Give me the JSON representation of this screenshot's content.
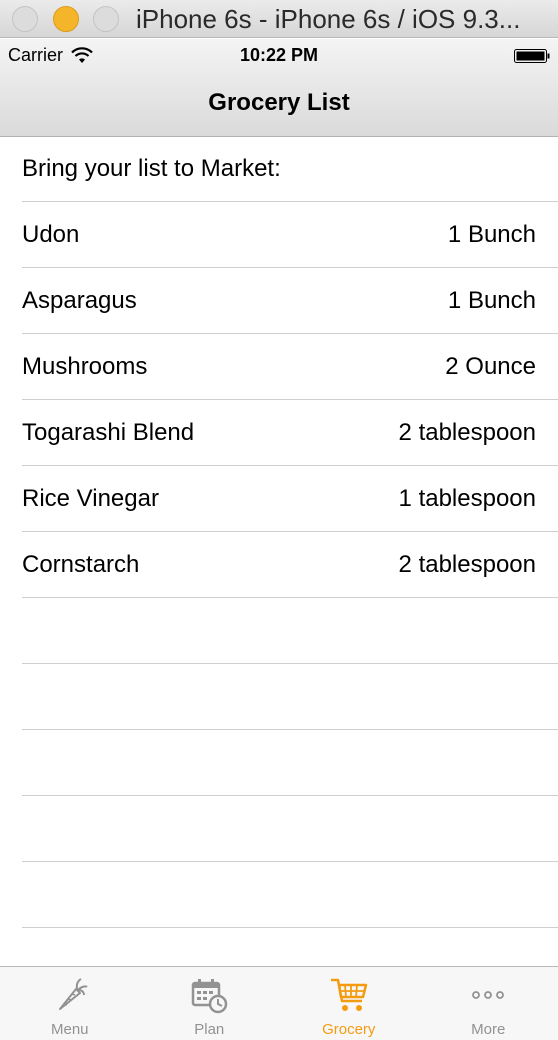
{
  "window": {
    "title": "iPhone 6s - iPhone 6s / iOS 9.3..."
  },
  "status_bar": {
    "carrier": "Carrier",
    "time": "10:22 PM"
  },
  "nav": {
    "title": "Grocery List"
  },
  "list": {
    "header": "Bring your list to Market:",
    "items": [
      {
        "name": "Udon",
        "quantity": "1 Bunch"
      },
      {
        "name": "Asparagus",
        "quantity": "1 Bunch"
      },
      {
        "name": "Mushrooms",
        "quantity": "2 Ounce"
      },
      {
        "name": "Togarashi Blend",
        "quantity": "2 tablespoon"
      },
      {
        "name": "Rice Vinegar",
        "quantity": "1 tablespoon"
      },
      {
        "name": "Cornstarch",
        "quantity": "2 tablespoon"
      }
    ]
  },
  "tabbar": {
    "tabs": [
      {
        "label": "Menu",
        "icon": "carrot-icon",
        "active": false
      },
      {
        "label": "Plan",
        "icon": "calendar-clock-icon",
        "active": false
      },
      {
        "label": "Grocery",
        "icon": "cart-icon",
        "active": true
      },
      {
        "label": "More",
        "icon": "more-icon",
        "active": false
      }
    ]
  },
  "colors": {
    "accent": "#f39c12",
    "inactive": "#929292"
  }
}
